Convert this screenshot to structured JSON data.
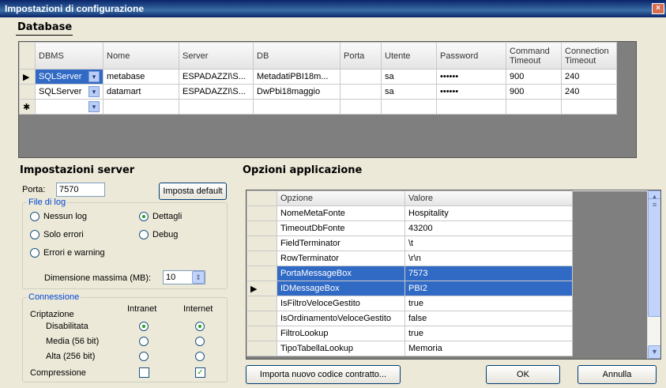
{
  "window": {
    "title": "Impostazioni di configurazione",
    "close": "×"
  },
  "database": {
    "title": "Database",
    "headers": [
      "DBMS",
      "Nome",
      "Server",
      "DB",
      "Porta",
      "Utente",
      "Password",
      "Command Timeout",
      "Connection Timeout"
    ],
    "rows": [
      {
        "marker": "▶",
        "dbms": "SQLServer",
        "nome": "metabase",
        "server": "ESPADAZZI\\S...",
        "db": "MetadatiPBI18m...",
        "porta": "",
        "utente": "sa",
        "password": "••••••",
        "cmd": "900",
        "conn": "240"
      },
      {
        "marker": "",
        "dbms": "SQLServer",
        "nome": "datamart",
        "server": "ESPADAZZI\\S...",
        "db": "DwPbi18maggio",
        "porta": "",
        "utente": "sa",
        "password": "••••••",
        "cmd": "900",
        "conn": "240"
      },
      {
        "marker": "✱",
        "dbms": "",
        "nome": "",
        "server": "",
        "db": "",
        "porta": "",
        "utente": "",
        "password": "",
        "cmd": "",
        "conn": ""
      }
    ]
  },
  "server": {
    "title": "Impostazioni server",
    "porta_label": "Porta:",
    "porta_value": "7570",
    "default_button": "Imposta default",
    "log_group": "File di log",
    "log_options": [
      "Nessun log",
      "Dettagli",
      "Solo errori",
      "Debug",
      "Errori e warning"
    ],
    "log_selected": "Dettagli",
    "maxsize_label": "Dimensione massima (MB):",
    "maxsize_value": "10",
    "conn_group": "Connessione",
    "col_intranet": "Intranet",
    "col_internet": "Internet",
    "criptazione": "Criptazione",
    "crypt_options": [
      "Disabilitata",
      "Media (56 bit)",
      "Alta (256 bit)"
    ],
    "compressione": "Compressione"
  },
  "options": {
    "title": "Opzioni applicazione",
    "headers": [
      "Opzione",
      "Valore"
    ],
    "rows": [
      {
        "name": "NomeMetaFonte",
        "value": "Hospitality",
        "selected": false,
        "marker": ""
      },
      {
        "name": "TimeoutDbFonte",
        "value": "43200",
        "selected": false,
        "marker": ""
      },
      {
        "name": "FieldTerminator",
        "value": "\\t",
        "selected": false,
        "marker": ""
      },
      {
        "name": "RowTerminator",
        "value": "\\r\\n",
        "selected": false,
        "marker": ""
      },
      {
        "name": "PortaMessageBox",
        "value": "7573",
        "selected": true,
        "marker": ""
      },
      {
        "name": "IDMessageBox",
        "value": "PBI2",
        "selected": true,
        "marker": "▶"
      },
      {
        "name": "IsFiltroVeloceGestito",
        "value": "true",
        "selected": false,
        "marker": ""
      },
      {
        "name": "IsOrdinamentoVeloceGestito",
        "value": "false",
        "selected": false,
        "marker": ""
      },
      {
        "name": "FiltroLookup",
        "value": "true",
        "selected": false,
        "marker": ""
      },
      {
        "name": "TipoTabellaLookup",
        "value": "Memoria",
        "selected": false,
        "marker": ""
      }
    ]
  },
  "buttons": {
    "import": "Importa nuovo codice contratto...",
    "ok": "OK",
    "cancel": "Annulla"
  }
}
